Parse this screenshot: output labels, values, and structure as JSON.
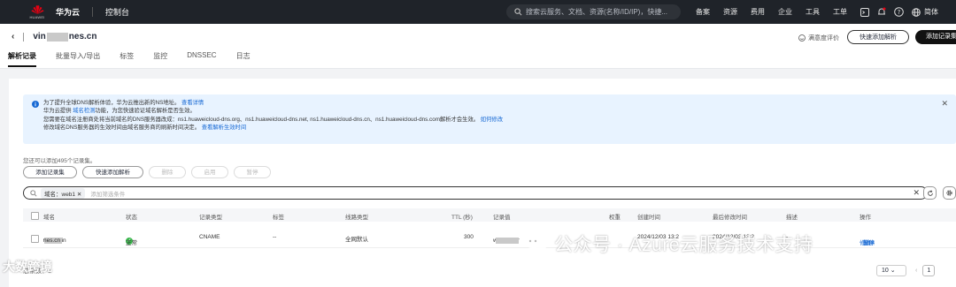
{
  "topbar": {
    "logo_text": "HUAWEI",
    "brand": "华为云",
    "console": "控制台",
    "search_placeholder": "搜索云服务、文档、资源(名称/ID/IP)，快捷...",
    "nav": [
      "备案",
      "资源",
      "费用",
      "企业",
      "工具",
      "工单"
    ],
    "lang": "简体"
  },
  "header": {
    "domain_prefix": "vin",
    "domain_suffix": "nes.cn",
    "satisfaction": "满意度评价",
    "quick_resolve": "快速添加解析",
    "add_record": "添加记录集"
  },
  "tabs": [
    "解析记录",
    "批量导入/导出",
    "标签",
    "监控",
    "DNSSEC",
    "日志"
  ],
  "notice": {
    "line1_text": "为了提升全球DNS解析体验，华为云推出新的NS地址。",
    "line1_link": "查看详情",
    "line2_pre": "华为云提供",
    "line2_link": "域名检测",
    "line2_post": "功能，为您快速验证域名解析是否生效。",
    "line3_text": "您需要在域名注册商处将当前域名的DNS服务器改成：ns1.huaweicloud-dns.org、ns1.huaweicloud-dns.net, ns1.huaweicloud-dns.cn、ns1.huaweicloud-dns.com解析才会生效。",
    "line3_link": "如何修改",
    "line4_text": "修改域名DNS服务器的生效时间由域名服务商的刷新时间决定。",
    "line4_link": "查看解析生效时间"
  },
  "remain_text": "您还可以添加495个记录集。",
  "toolbar": {
    "add": "添加记录集",
    "quick": "快速添加解析",
    "delete": "删除",
    "enable": "启用",
    "pause": "暂停"
  },
  "filter": {
    "tag": "域名：web1",
    "placeholder": "添加筛选条件"
  },
  "table": {
    "headers": [
      "域名",
      "状态",
      "记录类型",
      "标签",
      "线路类型",
      "TTL (秒)",
      "记录值",
      "权重",
      "创建时间",
      "最后修改时间",
      "描述",
      "操作"
    ],
    "row": {
      "domain_prefix": "web1.vin",
      "domain_suffix": "nes.cn",
      "status": "正常",
      "type": "CNAME",
      "tag": "--",
      "line": "全网默认",
      "ttl": "300",
      "value": "web1-micr",
      "weight": "",
      "created": "2024/12/03 13:2",
      "modified": "2024/12/03 13:2",
      "desc": "-",
      "ops": [
        "修改",
        "暂停",
        "删除"
      ]
    }
  },
  "pager": {
    "total_label": "总条数：1",
    "page_size": "10",
    "current_page": "1"
  },
  "watermarks": {
    "left": "大数跨境",
    "right": "公众号 · Azure云服务技术支持"
  }
}
